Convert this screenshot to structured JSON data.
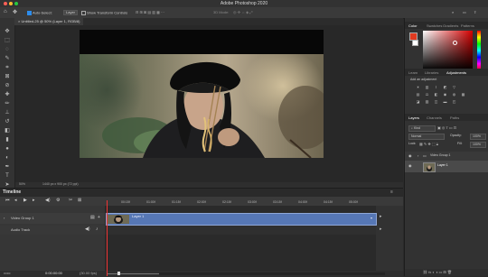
{
  "window": {
    "title": "Adobe Photoshop 2020",
    "traffic_lights": [
      "#ff5f57",
      "#febc2e",
      "#28c840"
    ]
  },
  "options_bar": {
    "auto_select_label": "Auto-Select:",
    "auto_select_value": "Layer",
    "show_transform_label": "Show Transform Controls",
    "mode_label": "3D Mode:"
  },
  "document": {
    "tab_title": "Untitled-25 @ 50% (Layer 1, RGB/8)"
  },
  "status_bar": {
    "zoom": "50%",
    "doc_info": "1440 px x 900 px (72 ppi)"
  },
  "timeline": {
    "title": "Timeline",
    "ruler_ticks": [
      "00:15f",
      "01:00f",
      "01:15f",
      "02:00f",
      "02:15f",
      "03:00f",
      "03:15f",
      "04:00f",
      "04:15f",
      "05:00f"
    ],
    "tracks": [
      {
        "name": "Video Group 1"
      },
      {
        "name": "Audio Track"
      }
    ],
    "clip_label": "Layer 1",
    "current_time": "0:00:00:00",
    "fps": "(30.00 fps)",
    "zoom_label": "100"
  },
  "panels": {
    "color_tabs": [
      "Color",
      "Swatches",
      "Gradients",
      "Patterns"
    ],
    "foreground_color": "#e03a20",
    "background_color": "#ffffff",
    "adjust_tabs": [
      "Learn",
      "Libraries",
      "Adjustments"
    ],
    "adjust_hint": "Add an adjustment",
    "layers_tabs": [
      "Layers",
      "Channels",
      "Paths"
    ],
    "layers_filter": "Kind",
    "blend_mode": "Normal",
    "opacity_label": "Opacity:",
    "opacity_value": "100%",
    "lock_label": "Lock:",
    "fill_label": "Fill:",
    "fill_value": "100%",
    "layers": [
      {
        "name": "Video Group 1",
        "type": "group"
      },
      {
        "name": "Layer 1",
        "type": "video-layer"
      }
    ]
  }
}
